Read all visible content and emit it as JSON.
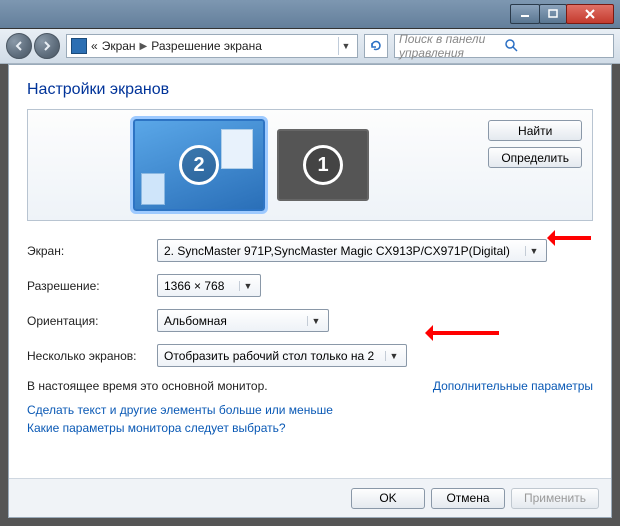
{
  "titlebar": {
    "minimize": "–",
    "maximize": "❐",
    "close": "✕"
  },
  "breadcrumb": {
    "prefix": "«",
    "item1": "Экран",
    "item2": "Разрешение экрана"
  },
  "search": {
    "placeholder": "Поиск в панели управления"
  },
  "page_title": "Настройки экранов",
  "monitors": {
    "num1": "1",
    "num2": "2"
  },
  "buttons": {
    "identify": "Найти",
    "detect": "Определить",
    "ok": "OK",
    "cancel": "Отмена",
    "apply": "Применить"
  },
  "labels": {
    "display": "Экран:",
    "resolution": "Разрешение:",
    "orientation": "Ориентация:",
    "multiple": "Несколько экранов:"
  },
  "values": {
    "display": "2. SyncMaster 971P,SyncMaster Magic CX913P/CX971P(Digital)",
    "resolution": "1366 × 768",
    "orientation": "Альбомная",
    "multiple": "Отобразить рабочий стол только на 2"
  },
  "status": "В настоящее время это основной монитор.",
  "links": {
    "advanced": "Дополнительные параметры",
    "textsize": "Сделать текст и другие элементы больше или меньше",
    "whichsettings": "Какие параметры монитора следует выбрать?"
  }
}
